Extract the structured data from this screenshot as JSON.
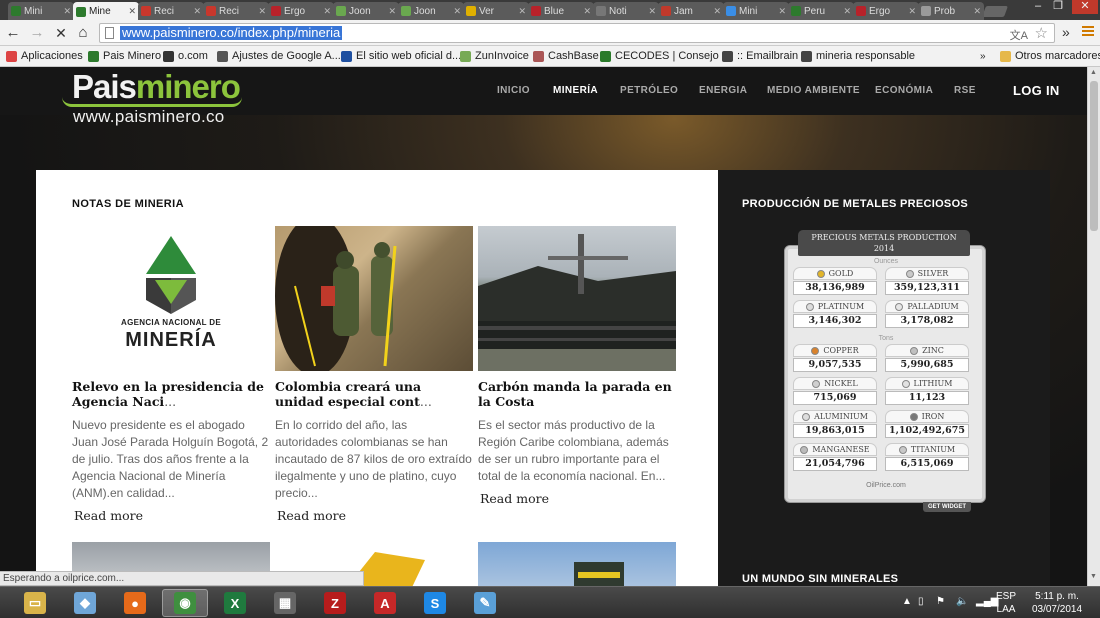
{
  "browser": {
    "tabs": [
      {
        "title": "Mini",
        "color": "#2d7a2d",
        "active": false
      },
      {
        "title": "Mine",
        "color": "#2d7a2d",
        "active": true
      },
      {
        "title": "Reci",
        "color": "#c9372c",
        "active": false
      },
      {
        "title": "Reci",
        "color": "#c9372c",
        "active": false
      },
      {
        "title": "Ergo",
        "color": "#b8222a",
        "active": false
      },
      {
        "title": "Joon",
        "color": "#6aa84f",
        "active": false
      },
      {
        "title": "Joon",
        "color": "#6aa84f",
        "active": false
      },
      {
        "title": "Ver",
        "color": "#e0b000",
        "active": false
      },
      {
        "title": "Blue",
        "color": "#b8222a",
        "active": false
      },
      {
        "title": "Noti",
        "color": "#777777",
        "active": false
      },
      {
        "title": "Jam",
        "color": "#c0392b",
        "active": false
      },
      {
        "title": "Mini",
        "color": "#3a8ee6",
        "active": false
      },
      {
        "title": "Peru",
        "color": "#2d7a2d",
        "active": false
      },
      {
        "title": "Ergo",
        "color": "#b8222a",
        "active": false
      },
      {
        "title": "Prob",
        "color": "#9a9a9a",
        "active": false
      }
    ],
    "url": "www.paisminero.co/index.php/mineria",
    "bookmarks": [
      {
        "label": "Aplicaciones",
        "icon": "apps-grid-icon",
        "color": "#d44"
      },
      {
        "label": "Pais Minero",
        "icon": "paisminero-favicon",
        "color": "#2d7a2d"
      },
      {
        "label": "o.com",
        "icon": "site-favicon",
        "color": "#333"
      },
      {
        "label": "Ajustes de Google A...",
        "icon": "adsense-favicon",
        "color": "#555"
      },
      {
        "label": "El sitio web oficial d...",
        "icon": "site-favicon",
        "color": "#1e4fa0"
      },
      {
        "label": "ZunInvoice",
        "icon": "zuninvoice-favicon",
        "color": "#7a5"
      },
      {
        "label": "CashBase",
        "icon": "cashbase-favicon",
        "color": "#a55"
      },
      {
        "label": "CECODES | Consejo ...",
        "icon": "cecodes-favicon",
        "color": "#2a7a2a"
      },
      {
        "label": ":: Emailbrain",
        "icon": "page-icon",
        "color": "#444"
      },
      {
        "label": "mineria responsable",
        "icon": "page-icon",
        "color": "#444"
      }
    ],
    "other_bookmarks": "Otros marcadores",
    "status_text": "Esperando a oilprice.com..."
  },
  "site": {
    "logo_pais": "Pais",
    "logo_minero": "minero",
    "logo_sub": "www.paisminero.co",
    "nav": [
      "INICIO",
      "MINERÍA",
      "PETRÓLEO",
      "ENERGIA",
      "MEDIO AMBIENTE",
      "ECONÓMIA",
      "RSE"
    ],
    "login": "LOG IN",
    "section_title": "NOTAS DE MINERIA",
    "articles": [
      {
        "title": "Relevo en la presidencia de Agencia Naci",
        "excerpt": "Nuevo presidente es el abogado Juan José Parada Holguín   Bogotá, 2 de julio. Tras dos años frente a la Agencia Nacional de Minería (ANM).en calidad...",
        "more": "Read more",
        "thumb_caption_1": "AGENCIA NACIONAL DE",
        "thumb_caption_2": "MINERÍA"
      },
      {
        "title": "Colombia creará una unidad especial cont",
        "excerpt": "En lo corrido del año, las autoridades colombianas se han incautado de 87 kilos de oro extraído ilegalmente y uno de platino, cuyo precio...",
        "more": "Read more"
      },
      {
        "title": "Carbón manda la parada en la Costa",
        "excerpt": "Es el sector más productivo de la Región Caribe colombiana, además de ser un rubro importante para el total de la economía nacional. En...",
        "more": "Read more"
      }
    ],
    "sidebar_title": "PRODUCCIÓN DE METALES PRECIOSOS",
    "sidebar_title_2": "UN MUNDO SIN MINERALES",
    "widget": {
      "head_1": "PRECIOUS METALS PRODUCTION",
      "head_2": "2014",
      "unit_ounces": "Ounces",
      "unit_tons": "Tons",
      "ounces": [
        {
          "name": "GOLD",
          "value": "38,136,989",
          "color": "#e2b52a"
        },
        {
          "name": "SILVER",
          "value": "359,123,311",
          "color": "#c9c9c9"
        },
        {
          "name": "PLATINUM",
          "value": "3,146,302",
          "color": "#dcdcdc"
        },
        {
          "name": "PALLADIUM",
          "value": "3,178,082",
          "color": "#e6e6e6"
        }
      ],
      "tons": [
        {
          "name": "COPPER",
          "value": "9,057,535",
          "color": "#d9822b"
        },
        {
          "name": "ZINC",
          "value": "5,990,685",
          "color": "#c0c0c0"
        },
        {
          "name": "NICKEL",
          "value": "715,069",
          "color": "#cfcfcf"
        },
        {
          "name": "LITHIUM",
          "value": "11,123",
          "color": "#e2e2e2"
        },
        {
          "name": "ALUMINIUM",
          "value": "19,863,015",
          "color": "#dddddd"
        },
        {
          "name": "IRON",
          "value": "1,102,492,675",
          "color": "#777777"
        },
        {
          "name": "MANGANESE",
          "value": "21,054,796",
          "color": "#bbbbbb"
        },
        {
          "name": "TITANIUM",
          "value": "6,515,069",
          "color": "#c8c8c8"
        }
      ],
      "footer": "OilPrice.com",
      "get_widget": "GET WIDGET"
    }
  },
  "taskbar": {
    "apps": [
      {
        "name": "file-explorer-icon",
        "glyph": "▭",
        "color": "#d9b44a",
        "active": false
      },
      {
        "name": "windows-photo-icon",
        "glyph": "◆",
        "color": "#6fa6d8",
        "active": false
      },
      {
        "name": "firefox-icon",
        "glyph": "●",
        "color": "#e66a1a",
        "active": false
      },
      {
        "name": "chrome-icon",
        "glyph": "◉",
        "color": "#3f8f3f",
        "active": true
      },
      {
        "name": "excel-icon",
        "glyph": "X",
        "color": "#1f7a3e",
        "active": false
      },
      {
        "name": "apps-icon",
        "glyph": "▦",
        "color": "#666666",
        "active": false
      },
      {
        "name": "filezilla-icon",
        "glyph": "Z",
        "color": "#b71c1c",
        "active": false
      },
      {
        "name": "acrobat-icon",
        "glyph": "A",
        "color": "#c62828",
        "active": false
      },
      {
        "name": "skype-icon",
        "glyph": "S",
        "color": "#1e88e5",
        "active": false
      },
      {
        "name": "paint-icon",
        "glyph": "✎",
        "color": "#5aa0d8",
        "active": false
      }
    ],
    "lang_1": "ESP",
    "lang_2": "LAA",
    "time": "5:11 p. m.",
    "date": "03/07/2014"
  }
}
